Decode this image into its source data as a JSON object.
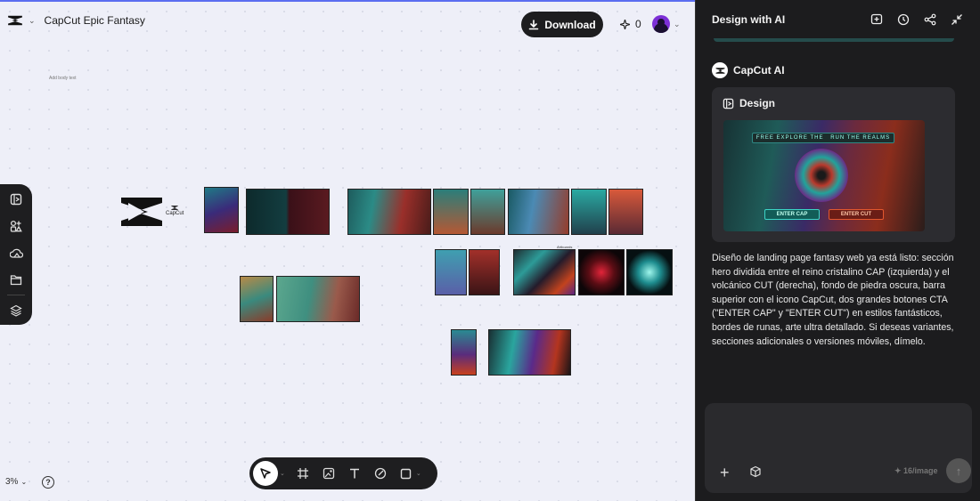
{
  "project": {
    "title": "CapCut Epic Fantasy"
  },
  "header": {
    "download_label": "Download",
    "credits": "0"
  },
  "canvas": {
    "add_body_text": "Add body text",
    "logo_caption": "CapCut",
    "artboard_label": "Artboards",
    "zoom": "3%",
    "help": "?"
  },
  "panel": {
    "title": "Design with AI",
    "assistant_name": "CapCut AI",
    "card_title": "Design",
    "thumb_nav": [
      "FREE EXPLORE THE",
      "RUN THE REALMS"
    ],
    "thumb_cap_button": "ENTER CAP",
    "thumb_cut_button": "ENTER CUT",
    "message": "Diseño de landing page fantasy web ya está listo: sección hero dividida entre el reino cristalino CAP (izquierda) y el volcánico CUT (derecha), fondo de piedra oscura, barra superior con el icono CapCut, dos grandes botones CTA (\"ENTER CAP\" y \"ENTER CUT\") en estilos fantásticos, bordes de runas, arte ultra detallado. Si deseas variantes, secciones adicionales o versiones móviles, dímelo.",
    "composer": {
      "cost": "✦ 16/image",
      "send": "↑"
    }
  },
  "colors": {
    "accent": "#5b6df0",
    "panel_bg": "#1c1c1e",
    "canvas_bg": "#eeeff8",
    "avatar": "#7c2fd6"
  }
}
